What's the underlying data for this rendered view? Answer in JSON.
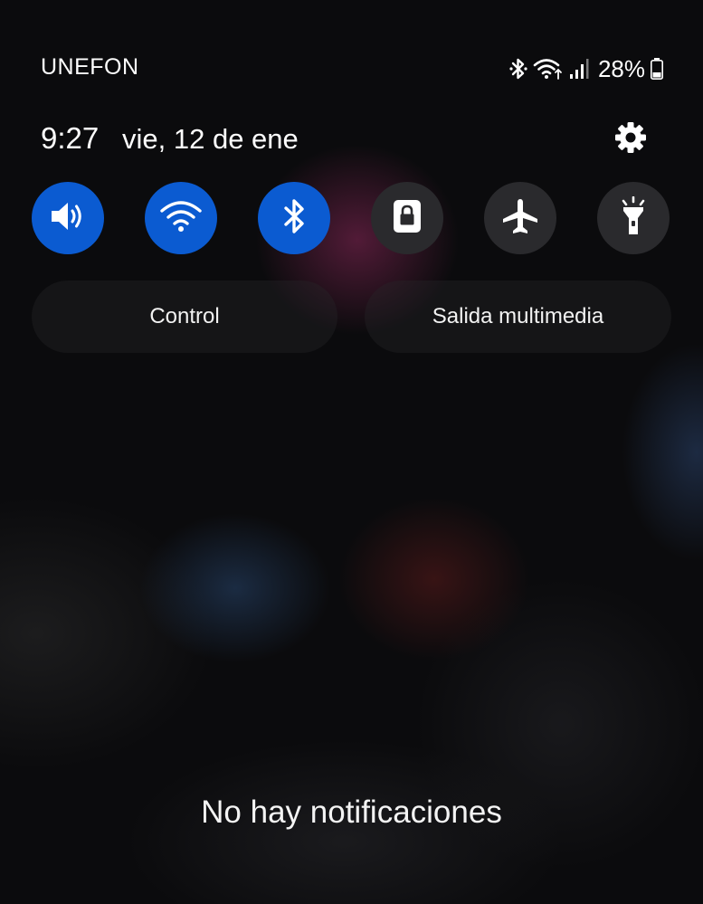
{
  "status_bar": {
    "carrier": "UNEFON",
    "battery_percent": "28%",
    "icons": [
      "bluetooth-icon",
      "wifi-icon",
      "signal-icon",
      "battery-icon"
    ]
  },
  "header": {
    "time": "9:27",
    "date": "vie, 12 de ene",
    "settings_icon": "gear-icon"
  },
  "quick_tiles": [
    {
      "icon": "sound-icon",
      "active": true
    },
    {
      "icon": "wifi-icon",
      "active": true
    },
    {
      "icon": "bluetooth-icon",
      "active": true
    },
    {
      "icon": "lock-icon",
      "active": false
    },
    {
      "icon": "airplane-icon",
      "active": false
    },
    {
      "icon": "flashlight-icon",
      "active": false
    }
  ],
  "media": {
    "control_label": "Control",
    "output_label": "Salida multimedia"
  },
  "notifications": {
    "empty_text": "No hay notificaciones"
  },
  "colors": {
    "tile_active": "#0b5bd1",
    "tile_inactive": "#2a2a2d",
    "background": "#0b0b0d"
  }
}
